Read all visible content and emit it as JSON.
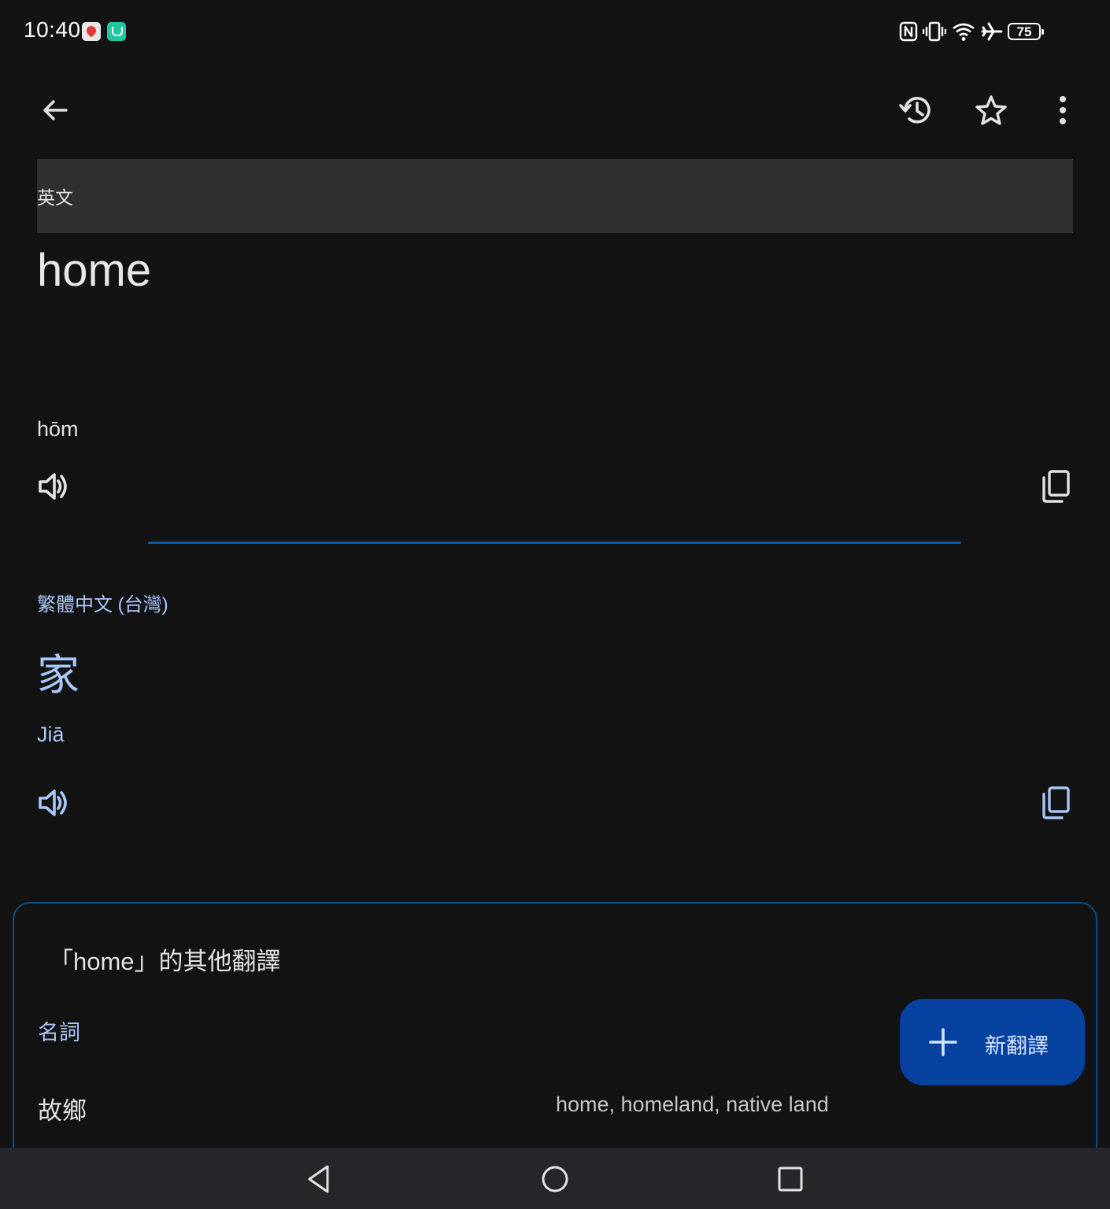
{
  "status_bar": {
    "time": "10:40",
    "battery": "75",
    "icons": [
      "map-notification-icon",
      "app-notification-icon",
      "nfc-icon",
      "vibrate-icon",
      "wifi-icon",
      "airplane-icon",
      "battery-icon"
    ]
  },
  "toolbar": {
    "icons": [
      "arrow-back-icon",
      "history-icon",
      "star-outline-icon",
      "more-vert-icon"
    ]
  },
  "source": {
    "language": "英文",
    "text": "home",
    "phonetic": "hōm"
  },
  "target": {
    "language": "繁體中文 (台灣)",
    "text": "家",
    "phonetic": "Jiā"
  },
  "other_translations": {
    "title": "「home」的其他翻譯",
    "part_of_speech": "名詞",
    "entries": [
      {
        "word": "故鄉",
        "meanings": "home, homeland, native land"
      }
    ]
  },
  "fab": {
    "label": "新翻譯"
  },
  "colors": {
    "background": "#131314",
    "accent_text": "#a8c7fa",
    "divider": "#0b57a8",
    "fab_background": "#0842a0",
    "source_bar": "#303030"
  },
  "nav_bar": {
    "icons": [
      "nav-back-icon",
      "nav-home-icon",
      "nav-recents-icon"
    ]
  }
}
